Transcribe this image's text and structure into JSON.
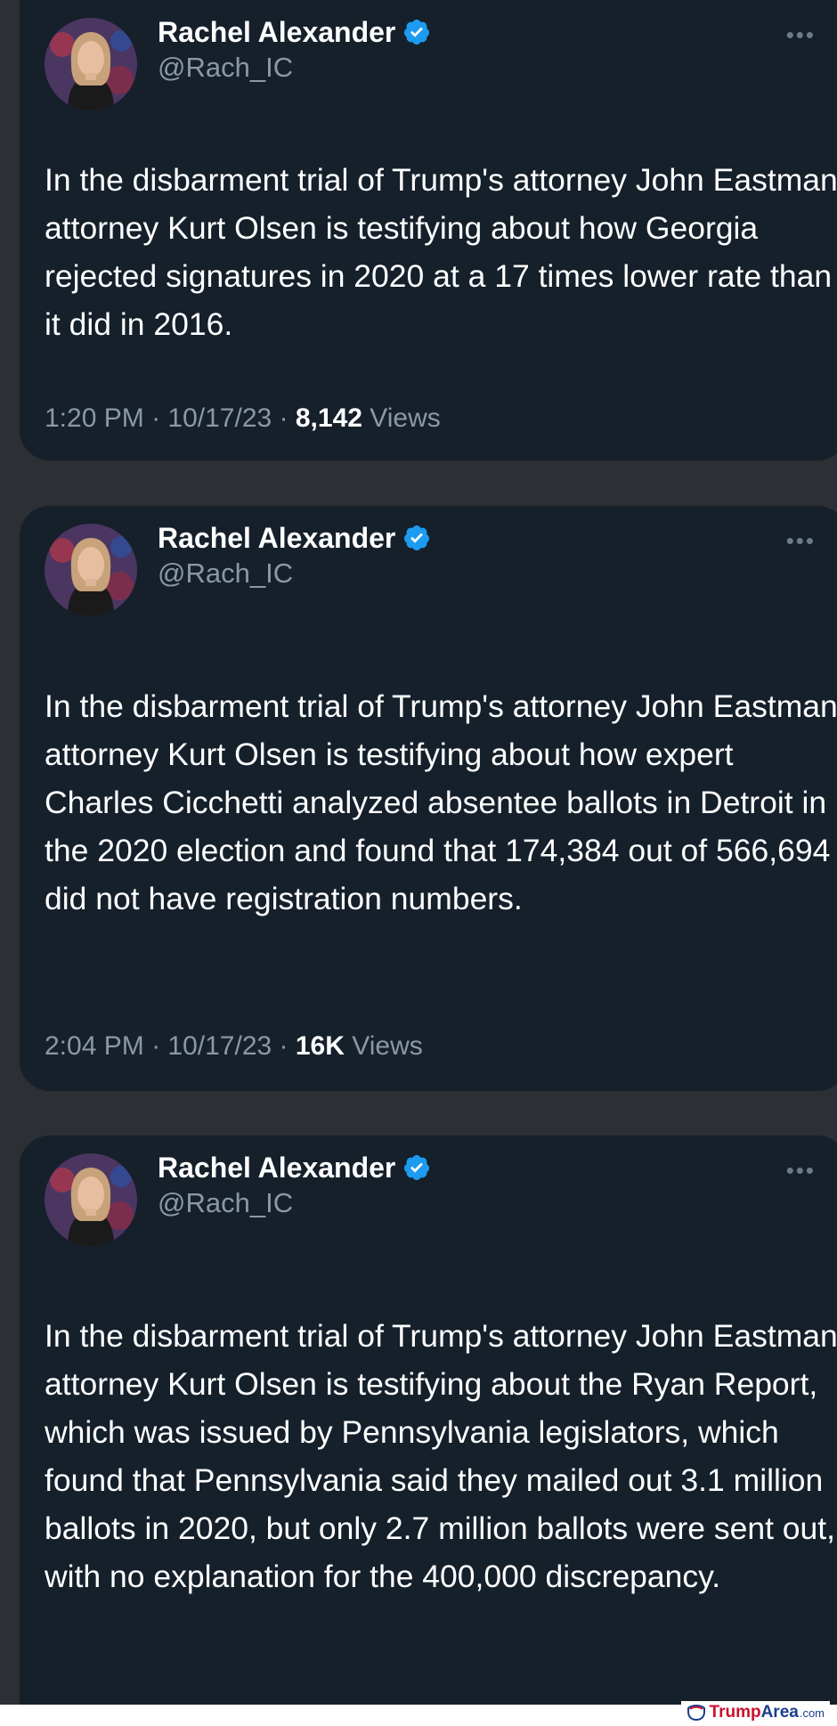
{
  "tweets": [
    {
      "author": "Rachel Alexander",
      "handle": "@Rach_IC",
      "text": "In the disbarment trial of Trump's attorney John Eastman, attorney Kurt Olsen is testifying about how Georgia rejected signatures in 2020 at a 17 times lower rate than it did in 2016.",
      "time": "1:20 PM",
      "date": "10/17/23",
      "views_count": "8,142",
      "views_label": "Views"
    },
    {
      "author": "Rachel Alexander",
      "handle": "@Rach_IC",
      "text": "In the disbarment trial of Trump's attorney John Eastman, attorney Kurt Olsen is testifying about how expert Charles Cicchetti analyzed absentee ballots in Detroit in the 2020 election and found that 174,384 out of 566,694 did not have registration numbers.",
      "time": "2:04 PM",
      "date": "10/17/23",
      "views_count": "16K",
      "views_label": "Views"
    },
    {
      "author": "Rachel Alexander",
      "handle": "@Rach_IC",
      "text": "In the disbarment trial of Trump's attorney John Eastman, attorney Kurt Olsen is testifying about the Ryan Report, which was issued by Pennsylvania legislators, which found that Pennsylvania said they mailed out 3.1 million ballots in 2020, but only 2.7 million ballots were sent out, with no explanation for the 400,000 discrepancy."
    }
  ],
  "meta_separator": " · ",
  "more_glyph": "•••",
  "watermark": {
    "brand_a": "Trump",
    "brand_b": "Area",
    "tld": ".com"
  },
  "colors": {
    "card_background": "#15202b",
    "page_background": "#2c2f33",
    "text_primary": "#ffffff",
    "text_secondary": "#8b98a5",
    "verified_badge": "#1d9bf0"
  },
  "icons": [
    "avatar",
    "verified-badge-icon",
    "more-options-icon",
    "trumparea-logo-icon"
  ]
}
